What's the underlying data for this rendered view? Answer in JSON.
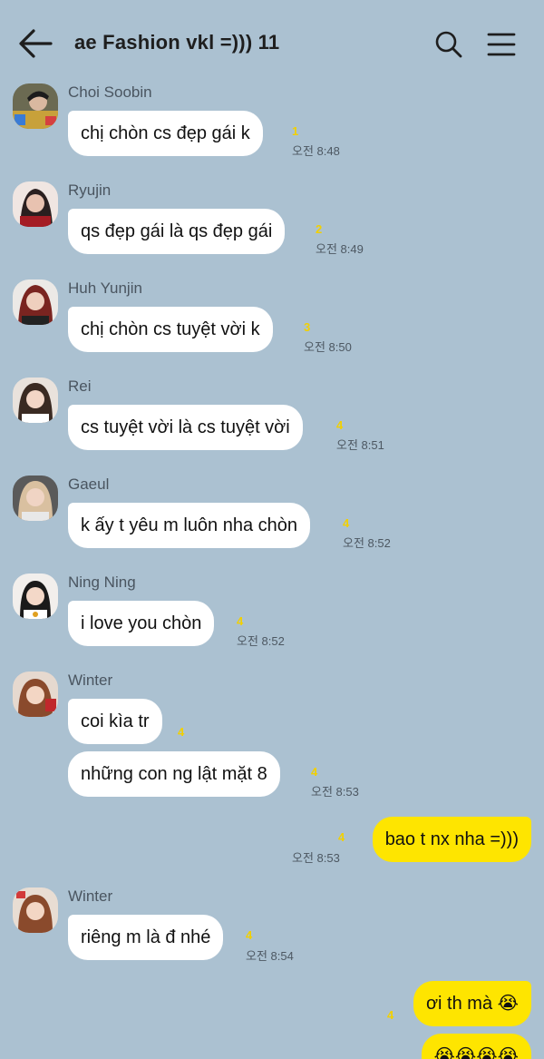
{
  "header": {
    "title": "ae Fashion vkl =))) 11",
    "back_icon": "arrow-left-icon",
    "search_icon": "search-icon",
    "menu_icon": "menu-icon"
  },
  "colors": {
    "background": "#abc1d1",
    "incoming_bubble": "#ffffff",
    "outgoing_bubble": "#fee500",
    "unread_count": "#f2d000"
  },
  "messages": [
    {
      "sender": "Choi Soobin",
      "text": "chị chòn cs đẹp gái k",
      "unread": "1",
      "time": "오전 8:48"
    },
    {
      "sender": "Ryujin",
      "text": "qs đẹp gái là qs đẹp gái",
      "unread": "2",
      "time": "오전 8:49"
    },
    {
      "sender": "Huh Yunjin",
      "text": "chị chòn cs tuyệt vời k",
      "unread": "3",
      "time": "오전 8:50"
    },
    {
      "sender": "Rei",
      "text": "cs tuyệt vời là cs tuyệt vời",
      "unread": "4",
      "time": "오전 8:51"
    },
    {
      "sender": "Gaeul",
      "text": "k ấy t yêu m luôn nha chòn",
      "unread": "4",
      "time": "오전 8:52"
    },
    {
      "sender": "Ning Ning",
      "text": "i love you chòn",
      "unread": "4",
      "time": "오전 8:52"
    },
    {
      "sender": "Winter",
      "text": "coi kìa tr",
      "unread": "4",
      "time": ""
    },
    {
      "sender": "",
      "text": "những con ng lật mặt 8",
      "unread": "4",
      "time": "오전 8:53"
    },
    {
      "sender": "me",
      "text": "bao t nx nha =)))",
      "unread": "4",
      "time": "오전 8:53"
    },
    {
      "sender": "Winter",
      "text": "riêng m là đ nhé",
      "unread": "4",
      "time": "오전 8:54"
    },
    {
      "sender": "me",
      "text": "ơi th mà 😭",
      "unread": "4",
      "time": ""
    },
    {
      "sender": "me",
      "text": "😭😭😭😭",
      "unread": "",
      "time": ""
    }
  ]
}
